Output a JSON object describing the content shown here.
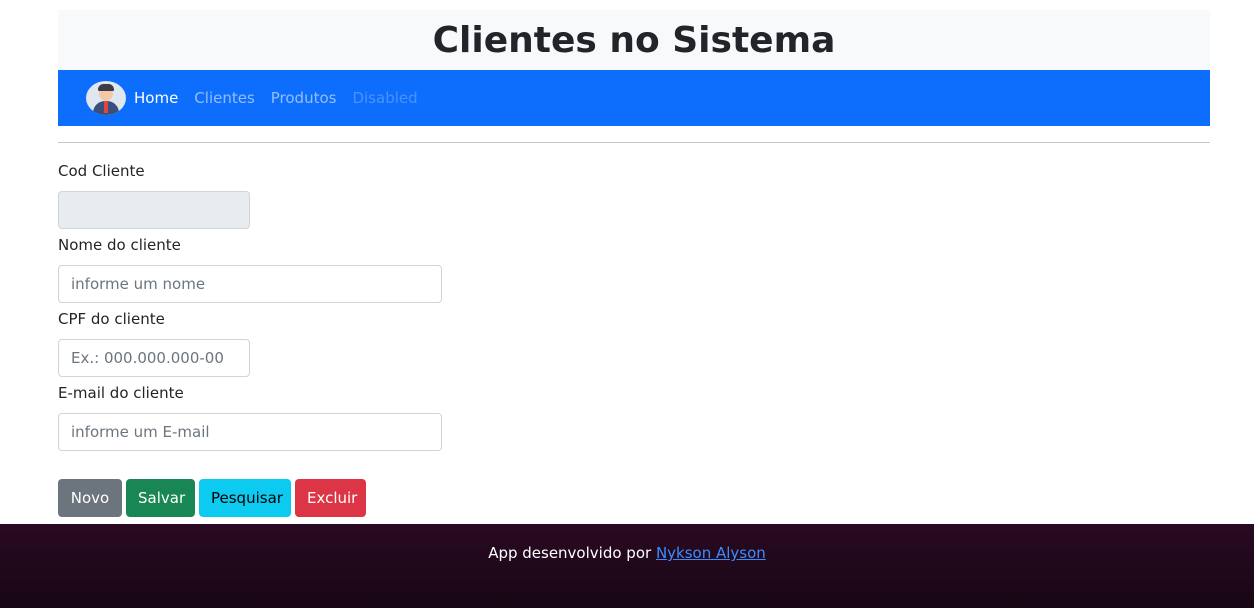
{
  "header": {
    "title": "Clientes no Sistema"
  },
  "navbar": {
    "items": [
      {
        "label": "Home"
      },
      {
        "label": "Clientes"
      },
      {
        "label": "Produtos"
      },
      {
        "label": "Disabled"
      }
    ]
  },
  "form": {
    "cod": {
      "label": "Cod Cliente",
      "value": ""
    },
    "nome": {
      "label": "Nome do cliente",
      "placeholder": "informe um nome"
    },
    "cpf": {
      "label": "CPF do cliente",
      "placeholder": "Ex.: 000.000.000-00"
    },
    "email": {
      "label": "E-mail do cliente",
      "placeholder": "informe um E-mail"
    }
  },
  "buttons": {
    "novo": "Novo",
    "salvar": "Salvar",
    "pesquisar": "Pesquisar",
    "excluir": "Excluir"
  },
  "footer": {
    "text": "App desenvolvido por",
    "author": "Nykson Alyson"
  },
  "colors": {
    "navbar": "#0d6efd",
    "novo": "#6c757d",
    "salvar": "#198754",
    "pesquisar": "#0dcaf0",
    "excluir": "#dc3545",
    "footer": "#1e0819"
  }
}
